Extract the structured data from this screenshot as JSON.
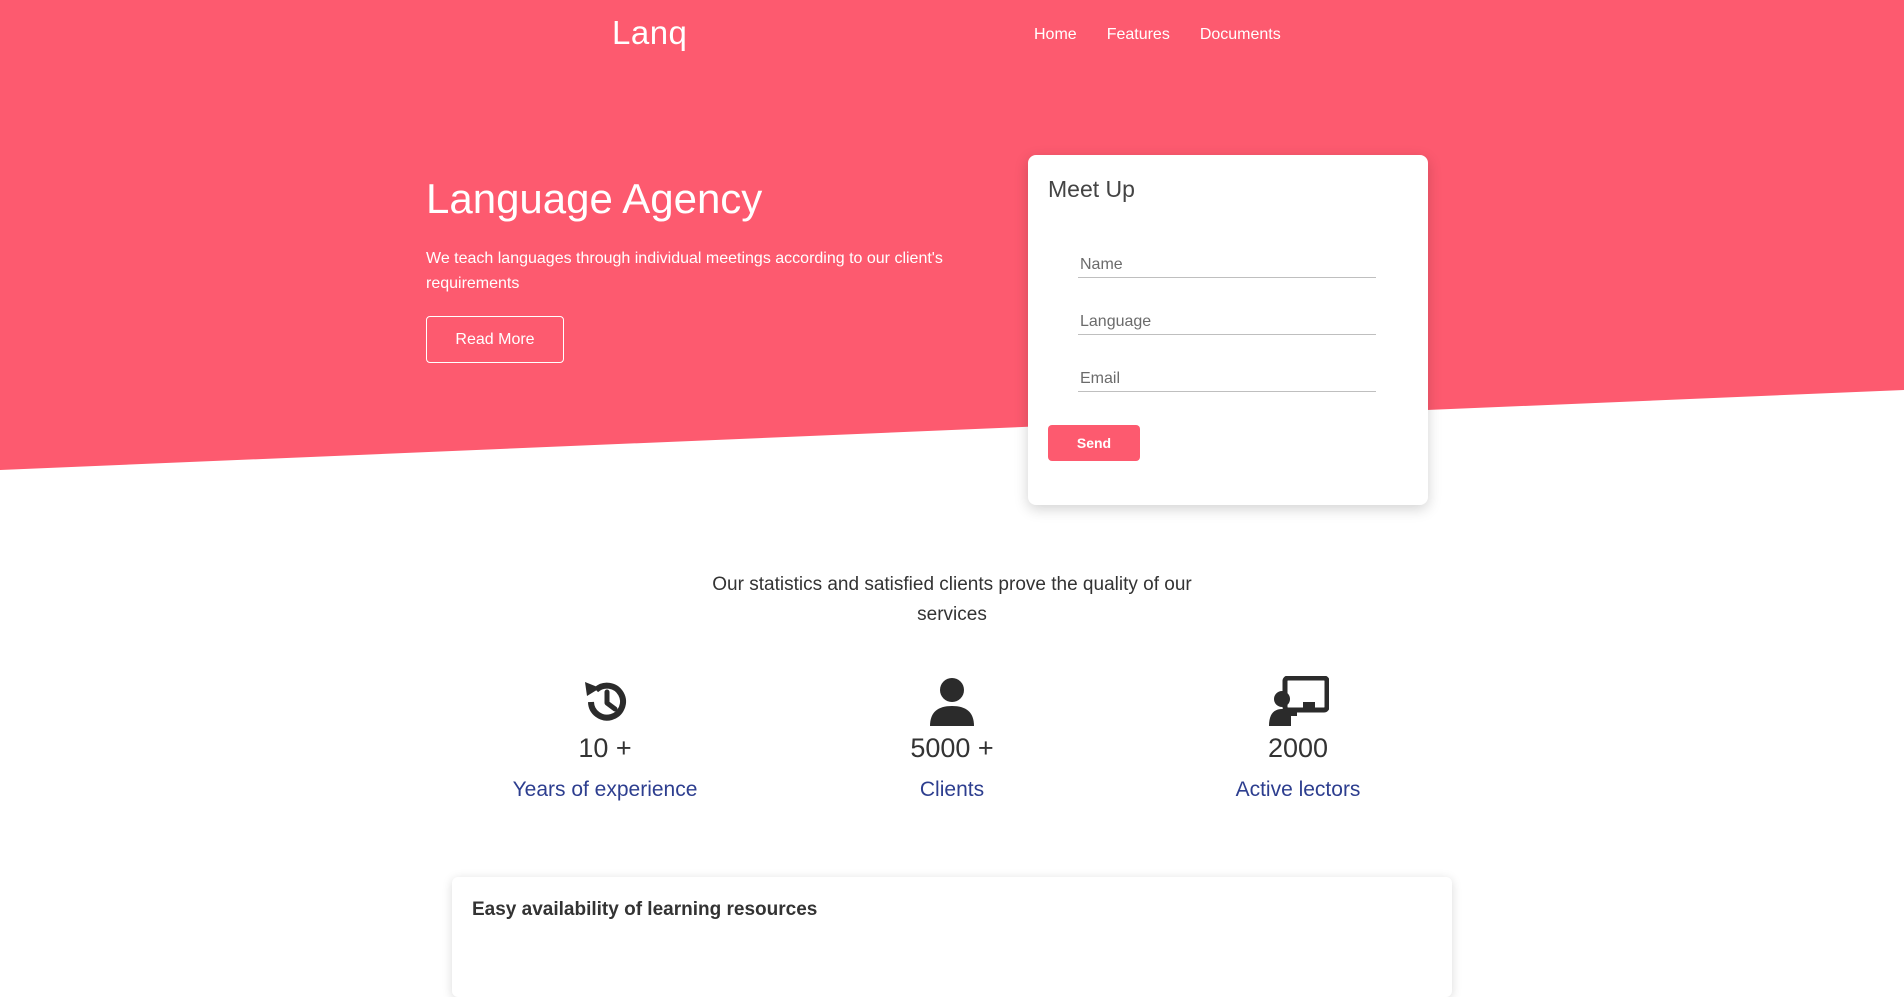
{
  "colors": {
    "accent": "#fd5a6f",
    "link_blue": "#2d3e8f",
    "icon_dark": "#2b2b2b"
  },
  "header": {
    "brand": "Lanq",
    "nav": [
      {
        "label": "Home"
      },
      {
        "label": "Features"
      },
      {
        "label": "Documents"
      }
    ]
  },
  "hero": {
    "title": "Language Agency",
    "subtitle": "We teach languages through individual meetings according to our client's requirements",
    "read_more_label": "Read More"
  },
  "meetup_form": {
    "title": "Meet Up",
    "fields": [
      {
        "placeholder": "Name",
        "value": ""
      },
      {
        "placeholder": "Language",
        "value": ""
      },
      {
        "placeholder": "Email",
        "value": ""
      }
    ],
    "send_label": "Send"
  },
  "stats": {
    "heading": "Our statistics and satisfied clients prove the quality of our services",
    "items": [
      {
        "icon": "history-icon",
        "value": "10 +",
        "label": "Years of experience"
      },
      {
        "icon": "user-icon",
        "value": "5000 +",
        "label": "Clients"
      },
      {
        "icon": "chalkboard-teacher-icon",
        "value": "2000",
        "label": "Active lectors"
      }
    ]
  },
  "resources": {
    "title": "Easy availability of learning resources"
  }
}
